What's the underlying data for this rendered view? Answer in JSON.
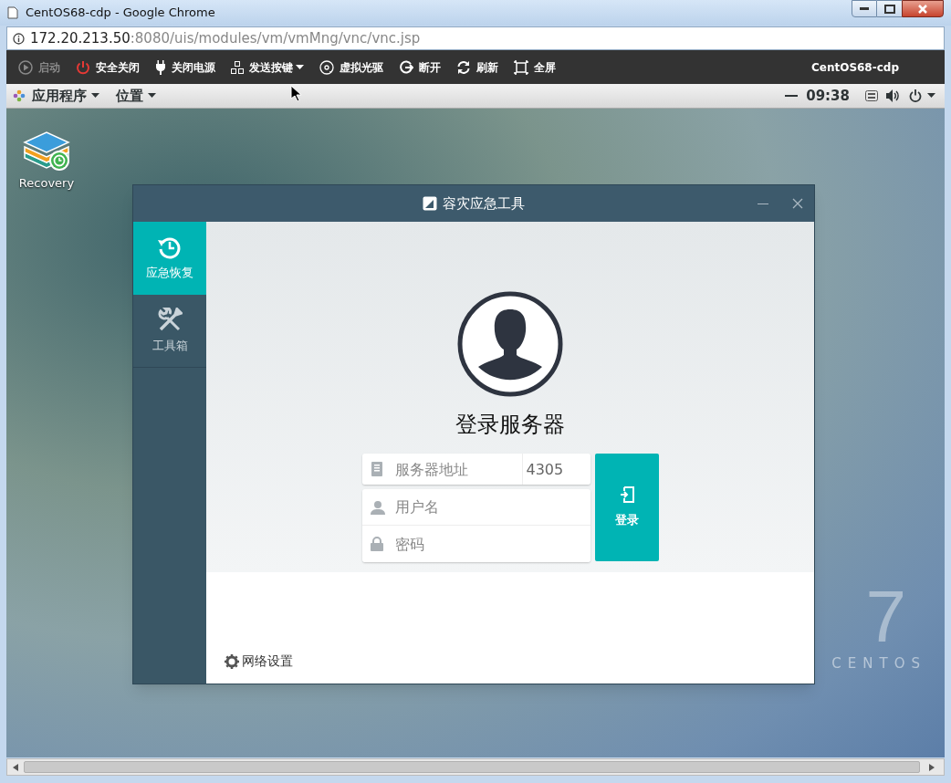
{
  "browser": {
    "title": "CentOS68-cdp - Google Chrome",
    "url_host": "172.20.213.50",
    "url_path": ":8080/uis/modules/vm/vmMng/vnc/vnc.jsp"
  },
  "toolbar": {
    "items": [
      {
        "label": "启动",
        "kind": "start",
        "disabled": true,
        "has_menu": false
      },
      {
        "label": "安全关闭",
        "kind": "shutdown",
        "disabled": false,
        "has_menu": false
      },
      {
        "label": "关闭电源",
        "kind": "power-off",
        "disabled": false,
        "has_menu": false
      },
      {
        "label": "发送按键",
        "kind": "keys",
        "disabled": false,
        "has_menu": true
      },
      {
        "label": "虚拟光驱",
        "kind": "disc",
        "disabled": false,
        "has_menu": false
      },
      {
        "label": "断开",
        "kind": "disconnect",
        "disabled": false,
        "has_menu": false
      },
      {
        "label": "刷新",
        "kind": "refresh",
        "disabled": false,
        "has_menu": false
      },
      {
        "label": "全屏",
        "kind": "fullscreen",
        "disabled": false,
        "has_menu": false
      }
    ],
    "vm_name": "CentOS68-cdp"
  },
  "top_bar": {
    "menus": [
      "应用程序",
      "位置"
    ],
    "clock": "09:38"
  },
  "desktop": {
    "icons": [
      {
        "label": "Recovery"
      }
    ],
    "logo_number": "7",
    "logo_text": "CENTOS"
  },
  "app": {
    "title": "容灾应急工具",
    "nav": [
      {
        "label": "应急恢复",
        "kind": "restore",
        "selected": true
      },
      {
        "label": "工具箱",
        "kind": "tools",
        "selected": false
      }
    ],
    "heading": "登录服务器",
    "server_placeholder": "服务器地址",
    "port_value": "4305",
    "username_placeholder": "用户名",
    "password_placeholder": "密码",
    "login_button": "登录",
    "network_settings": "网络设置"
  }
}
